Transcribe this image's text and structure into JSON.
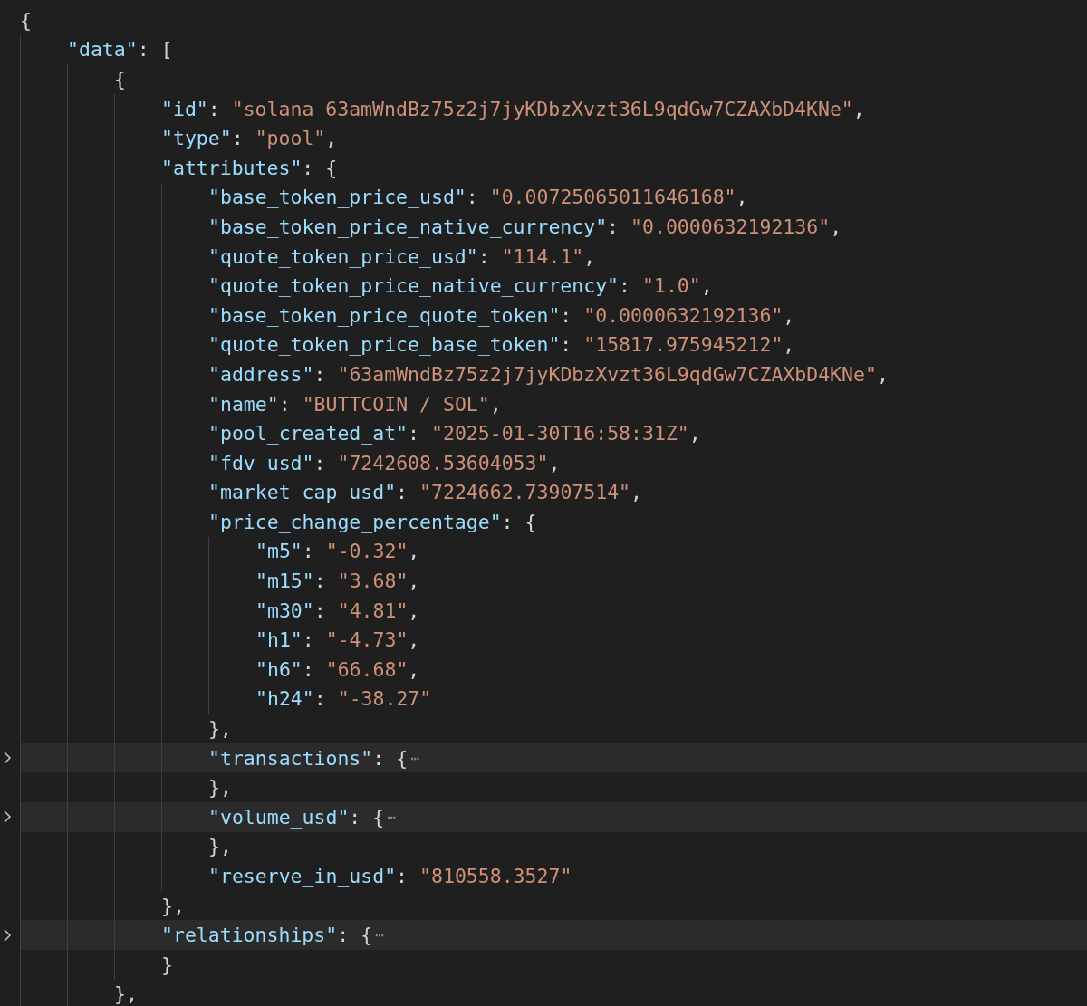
{
  "editor": {
    "lines": [
      {
        "tokens": [
          {
            "kind": "punct",
            "text": "{"
          }
        ],
        "children": [
          {
            "tokens": [
              {
                "kind": "key",
                "text": "\"data\""
              },
              {
                "kind": "colon",
                "text": ":"
              },
              {
                "kind": "punct",
                "text": "["
              }
            ],
            "children": [
              {
                "tokens": [
                  {
                    "kind": "punct",
                    "text": "{"
                  }
                ],
                "children": [
                  {
                    "tokens": [
                      {
                        "kind": "key",
                        "text": "\"id\""
                      },
                      {
                        "kind": "colon",
                        "text": ":"
                      },
                      {
                        "kind": "string",
                        "text": "\"solana_63amWndBz75z2j7jyKDbzXvzt36L9qdGw7CZAXbD4KNe\""
                      },
                      {
                        "kind": "punct",
                        "text": ","
                      }
                    ]
                  },
                  {
                    "tokens": [
                      {
                        "kind": "key",
                        "text": "\"type\""
                      },
                      {
                        "kind": "colon",
                        "text": ":"
                      },
                      {
                        "kind": "string",
                        "text": "\"pool\""
                      },
                      {
                        "kind": "punct",
                        "text": ","
                      }
                    ]
                  },
                  {
                    "tokens": [
                      {
                        "kind": "key",
                        "text": "\"attributes\""
                      },
                      {
                        "kind": "colon",
                        "text": ":"
                      },
                      {
                        "kind": "punct",
                        "text": "{"
                      }
                    ],
                    "children": [
                      {
                        "tokens": [
                          {
                            "kind": "key",
                            "text": "\"base_token_price_usd\""
                          },
                          {
                            "kind": "colon",
                            "text": ":"
                          },
                          {
                            "kind": "string",
                            "text": "\"0.00725065011646168\""
                          },
                          {
                            "kind": "punct",
                            "text": ","
                          }
                        ]
                      },
                      {
                        "tokens": [
                          {
                            "kind": "key",
                            "text": "\"base_token_price_native_currency\""
                          },
                          {
                            "kind": "colon",
                            "text": ":"
                          },
                          {
                            "kind": "string",
                            "text": "\"0.0000632192136\""
                          },
                          {
                            "kind": "punct",
                            "text": ","
                          }
                        ]
                      },
                      {
                        "tokens": [
                          {
                            "kind": "key",
                            "text": "\"quote_token_price_usd\""
                          },
                          {
                            "kind": "colon",
                            "text": ":"
                          },
                          {
                            "kind": "string",
                            "text": "\"114.1\""
                          },
                          {
                            "kind": "punct",
                            "text": ","
                          }
                        ]
                      },
                      {
                        "tokens": [
                          {
                            "kind": "key",
                            "text": "\"quote_token_price_native_currency\""
                          },
                          {
                            "kind": "colon",
                            "text": ":"
                          },
                          {
                            "kind": "string",
                            "text": "\"1.0\""
                          },
                          {
                            "kind": "punct",
                            "text": ","
                          }
                        ]
                      },
                      {
                        "tokens": [
                          {
                            "kind": "key",
                            "text": "\"base_token_price_quote_token\""
                          },
                          {
                            "kind": "colon",
                            "text": ":"
                          },
                          {
                            "kind": "string",
                            "text": "\"0.0000632192136\""
                          },
                          {
                            "kind": "punct",
                            "text": ","
                          }
                        ]
                      },
                      {
                        "tokens": [
                          {
                            "kind": "key",
                            "text": "\"quote_token_price_base_token\""
                          },
                          {
                            "kind": "colon",
                            "text": ":"
                          },
                          {
                            "kind": "string",
                            "text": "\"15817.975945212\""
                          },
                          {
                            "kind": "punct",
                            "text": ","
                          }
                        ]
                      },
                      {
                        "tokens": [
                          {
                            "kind": "key",
                            "text": "\"address\""
                          },
                          {
                            "kind": "colon",
                            "text": ":"
                          },
                          {
                            "kind": "string",
                            "text": "\"63amWndBz75z2j7jyKDbzXvzt36L9qdGw7CZAXbD4KNe\""
                          },
                          {
                            "kind": "punct",
                            "text": ","
                          }
                        ]
                      },
                      {
                        "tokens": [
                          {
                            "kind": "key",
                            "text": "\"name\""
                          },
                          {
                            "kind": "colon",
                            "text": ":"
                          },
                          {
                            "kind": "string",
                            "text": "\"BUTTCOIN / SOL\""
                          },
                          {
                            "kind": "punct",
                            "text": ","
                          }
                        ]
                      },
                      {
                        "tokens": [
                          {
                            "kind": "key",
                            "text": "\"pool_created_at\""
                          },
                          {
                            "kind": "colon",
                            "text": ":"
                          },
                          {
                            "kind": "string",
                            "text": "\"2025-01-30T16:58:31Z\""
                          },
                          {
                            "kind": "punct",
                            "text": ","
                          }
                        ]
                      },
                      {
                        "tokens": [
                          {
                            "kind": "key",
                            "text": "\"fdv_usd\""
                          },
                          {
                            "kind": "colon",
                            "text": ":"
                          },
                          {
                            "kind": "string",
                            "text": "\"7242608.53604053\""
                          },
                          {
                            "kind": "punct",
                            "text": ","
                          }
                        ]
                      },
                      {
                        "tokens": [
                          {
                            "kind": "key",
                            "text": "\"market_cap_usd\""
                          },
                          {
                            "kind": "colon",
                            "text": ":"
                          },
                          {
                            "kind": "string",
                            "text": "\"7224662.73907514\""
                          },
                          {
                            "kind": "punct",
                            "text": ","
                          }
                        ]
                      },
                      {
                        "tokens": [
                          {
                            "kind": "key",
                            "text": "\"price_change_percentage\""
                          },
                          {
                            "kind": "colon",
                            "text": ":"
                          },
                          {
                            "kind": "punct",
                            "text": "{"
                          }
                        ],
                        "children": [
                          {
                            "tokens": [
                              {
                                "kind": "key",
                                "text": "\"m5\""
                              },
                              {
                                "kind": "colon",
                                "text": ":"
                              },
                              {
                                "kind": "string",
                                "text": "\"-0.32\""
                              },
                              {
                                "kind": "punct",
                                "text": ","
                              }
                            ]
                          },
                          {
                            "tokens": [
                              {
                                "kind": "key",
                                "text": "\"m15\""
                              },
                              {
                                "kind": "colon",
                                "text": ":"
                              },
                              {
                                "kind": "string",
                                "text": "\"3.68\""
                              },
                              {
                                "kind": "punct",
                                "text": ","
                              }
                            ]
                          },
                          {
                            "tokens": [
                              {
                                "kind": "key",
                                "text": "\"m30\""
                              },
                              {
                                "kind": "colon",
                                "text": ":"
                              },
                              {
                                "kind": "string",
                                "text": "\"4.81\""
                              },
                              {
                                "kind": "punct",
                                "text": ","
                              }
                            ]
                          },
                          {
                            "tokens": [
                              {
                                "kind": "key",
                                "text": "\"h1\""
                              },
                              {
                                "kind": "colon",
                                "text": ":"
                              },
                              {
                                "kind": "string",
                                "text": "\"-4.73\""
                              },
                              {
                                "kind": "punct",
                                "text": ","
                              }
                            ]
                          },
                          {
                            "tokens": [
                              {
                                "kind": "key",
                                "text": "\"h6\""
                              },
                              {
                                "kind": "colon",
                                "text": ":"
                              },
                              {
                                "kind": "string",
                                "text": "\"66.68\""
                              },
                              {
                                "kind": "punct",
                                "text": ","
                              }
                            ]
                          },
                          {
                            "tokens": [
                              {
                                "kind": "key",
                                "text": "\"h24\""
                              },
                              {
                                "kind": "colon",
                                "text": ":"
                              },
                              {
                                "kind": "string",
                                "text": "\"-38.27\""
                              }
                            ]
                          }
                        ]
                      },
                      {
                        "tokens": [
                          {
                            "kind": "punct",
                            "text": "},"
                          }
                        ]
                      },
                      {
                        "collapsed": true,
                        "tokens": [
                          {
                            "kind": "key",
                            "text": "\"transactions\""
                          },
                          {
                            "kind": "colon",
                            "text": ":"
                          },
                          {
                            "kind": "punct",
                            "text": "{"
                          },
                          {
                            "kind": "fold",
                            "text": "⋯"
                          }
                        ]
                      },
                      {
                        "tokens": [
                          {
                            "kind": "punct",
                            "text": "},"
                          }
                        ]
                      },
                      {
                        "collapsed": true,
                        "tokens": [
                          {
                            "kind": "key",
                            "text": "\"volume_usd\""
                          },
                          {
                            "kind": "colon",
                            "text": ":"
                          },
                          {
                            "kind": "punct",
                            "text": "{"
                          },
                          {
                            "kind": "fold",
                            "text": "⋯"
                          }
                        ]
                      },
                      {
                        "tokens": [
                          {
                            "kind": "punct",
                            "text": "},"
                          }
                        ]
                      },
                      {
                        "tokens": [
                          {
                            "kind": "key",
                            "text": "\"reserve_in_usd\""
                          },
                          {
                            "kind": "colon",
                            "text": ":"
                          },
                          {
                            "kind": "string",
                            "text": "\"810558.3527\""
                          }
                        ]
                      }
                    ]
                  },
                  {
                    "tokens": [
                      {
                        "kind": "punct",
                        "text": "},"
                      }
                    ]
                  },
                  {
                    "collapsed": true,
                    "tokens": [
                      {
                        "kind": "key",
                        "text": "\"relationships\""
                      },
                      {
                        "kind": "colon",
                        "text": ":"
                      },
                      {
                        "kind": "punct",
                        "text": "{"
                      },
                      {
                        "kind": "fold",
                        "text": "⋯"
                      }
                    ]
                  },
                  {
                    "tokens": [
                      {
                        "kind": "punct",
                        "text": "}"
                      }
                    ]
                  }
                ]
              },
              {
                "tokens": [
                  {
                    "kind": "punct",
                    "text": "},"
                  }
                ]
              }
            ]
          }
        ]
      }
    ]
  }
}
